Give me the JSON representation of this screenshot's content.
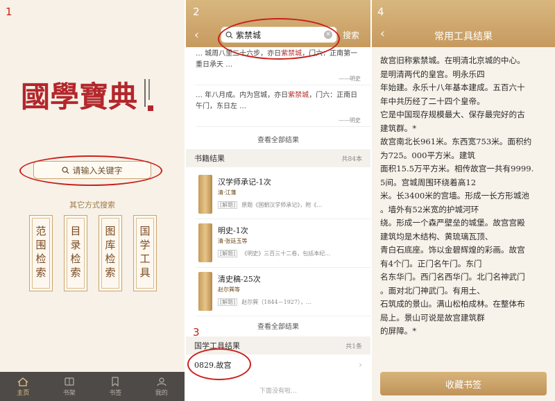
{
  "steps": {
    "one": "1",
    "two": "2",
    "three": "3",
    "four": "4"
  },
  "home": {
    "logo_text": "國學寶典",
    "search_placeholder": "请输入关键字",
    "other_search_label": "其它方式搜索",
    "tiles": [
      "范围检索",
      "目录检索",
      "图库检索",
      "国学工具"
    ],
    "tabs": [
      "主页",
      "书架",
      "书签",
      "我的"
    ],
    "active_tab_index": 0
  },
  "search_results": {
    "query": "紫禁城",
    "search_button": "搜索",
    "snippet1": {
      "before": "… 城周八里二十六步，亦日",
      "highlight": "紫禁城",
      "after": "，门六：正南第一重日承天 …"
    },
    "snippet1_source": "——明史",
    "snippet2": {
      "before": "… 年八月成。内为宫城，亦日",
      "highlight": "紫禁城",
      "after": "，门六：正南日午门，东日左 …"
    },
    "snippet2_source": "——明史",
    "view_all_1": "查看全部结果",
    "books_header": "书籍结果",
    "books_count": "共84本",
    "books": [
      {
        "title": "汉学师承记-1次",
        "author": "清·江藩",
        "tag": "[解题]",
        "desc": "原题《国朝汉学师承记》，附《…"
      },
      {
        "title": "明史-1次",
        "author": "清·张廷玉等",
        "tag": "[解题]",
        "desc": "《明史》三百三十二卷，包括本纪…"
      },
      {
        "title": "清史稿-25次",
        "author": "赵尔巽等",
        "tag": "[解题]",
        "desc": "赵尔巽（1844－1927），…"
      }
    ],
    "view_all_2": "查看全部结果",
    "tools_header": "国学工具结果",
    "tools_count": "共1条",
    "tool_result": "0829.故宫",
    "no_more": "下面没有啦…"
  },
  "detail": {
    "title": "常用工具结果",
    "lines": [
      "故宫旧称紫禁城。在明清北京城的中心。",
      "是明清两代的皇宫。明永乐四",
      "年始建。永乐十八年基本建成。五百六十",
      "年中共历经了二十四个皇帝。",
      "它是中国现存规模最大、保存最完好的古",
      "建筑群。*",
      "故宫南北长961米。东西宽753米。面积约",
      "为725。000平方米。建筑",
      "面积15.5万平方米。相传故宫一共有9999.",
      "5间。宫城周围环绕着高12",
      "米。长3400米的宫墙。形成一长方形城池",
      "。墙外有52米宽的护城河环",
      "绕。形成一个森严壁垒的城堡。故宫宫殿",
      "建筑均是木结构、黄琉璃瓦顶、",
      "青白石底座。饰以金碧辉煌的彩画。故宫",
      "有4个门。正门名午门。东门",
      "名东华门。西门名西华门。北门名神武门",
      "。面对北门神武门。有用土、",
      "石筑成的景山。满山松柏成林。在整体布",
      "局上。景山可说是故宫建筑群",
      "的屏障。*"
    ],
    "bookmark_button": "收藏书签"
  }
}
